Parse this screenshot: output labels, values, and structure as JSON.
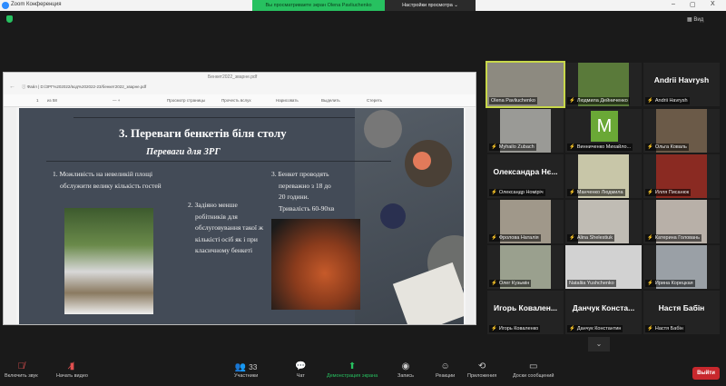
{
  "window": {
    "title": "Zoom Конференция",
    "minimize": "–",
    "maximize": "▢",
    "close": "X"
  },
  "share_banner": {
    "text": "Вы просматриваете экран Olena Pavliuchenko",
    "view_options": "Настройки просмотра ⌄"
  },
  "view_button": "▦ Вид",
  "browser": {
    "tab_title": "Бенкет2022_зварнe.pdf",
    "address": "ⓘ Файл | D:/ЗРГ%202022/вод%202022-23/бенкет2022_зварне.pdf",
    "pdf_toolbar": {
      "page": "1",
      "of": "из 58",
      "draw": "Нарисовать",
      "highlight": "Выделить",
      "erase": "Стереть",
      "page_view": "Просмотр страницы",
      "read_aloud": "Прочесть вслух"
    }
  },
  "slide": {
    "title": "3. Переваги бенкетів біля столу",
    "subtitle": "Переваги для ЗРГ",
    "point1": [
      "1. Можливість на невеликій площі",
      "обслужити велику кількість гостей"
    ],
    "point2": [
      "2. Задіяно менше",
      "робітників для",
      "обслуговування такої ж",
      "кількісті осіб як і при",
      "класичному бенкеті"
    ],
    "point3": [
      "3. Бенкет проводять",
      "переважно з 18 до",
      "20 години.",
      "Тривалість 60-90хв"
    ]
  },
  "participants": [
    {
      "label": "Olena Pavliuchenko",
      "muted": false,
      "video": true,
      "active": true,
      "color": "#8d8a80"
    },
    {
      "label": "Людмила Дейниченко",
      "muted": true,
      "video": true,
      "color": "#5a7a3a"
    },
    {
      "label": "Andrii Havrysh",
      "muted": true,
      "video": false,
      "big": "Andrii Havrysh"
    },
    {
      "label": "Myhailo Zubach",
      "muted": true,
      "video": true,
      "color": "#9a9a96"
    },
    {
      "label": "Винниченко Михайло...",
      "muted": true,
      "video": false,
      "avatar": "M"
    },
    {
      "label": "Ольга Коваль",
      "muted": true,
      "video": true,
      "color": "#6b5a48"
    },
    {
      "label": "Олександр Номірiч",
      "muted": true,
      "video": false,
      "big": "Олександра  Нє..."
    },
    {
      "label": "Манченко Людмила",
      "muted": true,
      "video": true,
      "color": "#c8c6a8"
    },
    {
      "label": "Илля Писанюк",
      "muted": true,
      "video": true,
      "color": "#8a2a22"
    },
    {
      "label": "Фролова Наталія",
      "muted": true,
      "video": true,
      "color": "#a0988a"
    },
    {
      "label": "Alina Shelestiuk",
      "muted": true,
      "video": true,
      "color": "#c0bcb4"
    },
    {
      "label": "Катерина Головань",
      "muted": true,
      "video": true,
      "color": "#b8b0a8"
    },
    {
      "label": "Олег Кузьмін",
      "muted": true,
      "video": true,
      "color": "#9aa08e"
    },
    {
      "label": "Nataliia Yushchenko",
      "muted": false,
      "video": true,
      "color": "#d2d2d2"
    },
    {
      "label": "Ирина Корецкая",
      "muted": true,
      "video": true,
      "color": "#9aa0a6"
    },
    {
      "label": "Игорь Коваленко",
      "muted": true,
      "video": false,
      "big": "Игорь  Ковален..."
    },
    {
      "label": "Данчук Константин",
      "muted": true,
      "video": false,
      "big": "Данчук  Конста..."
    },
    {
      "label": "Настя Бабін",
      "muted": true,
      "video": false,
      "big": "Настя Бабін"
    }
  ],
  "toolbar": {
    "audio": "Включить звук",
    "video": "Начать видео",
    "participants": "Участники",
    "participants_count": "33",
    "chat": "Чат",
    "share": "Демонстрация экрана",
    "record": "Запись",
    "reactions": "Реакции",
    "apps": "Приложения",
    "whiteboards": "Доски сообщений",
    "leave": "Выйти"
  },
  "colors": {
    "share_green": "#27c160",
    "leave_red": "#c8282d",
    "active_speaker": "#c8d84a"
  }
}
